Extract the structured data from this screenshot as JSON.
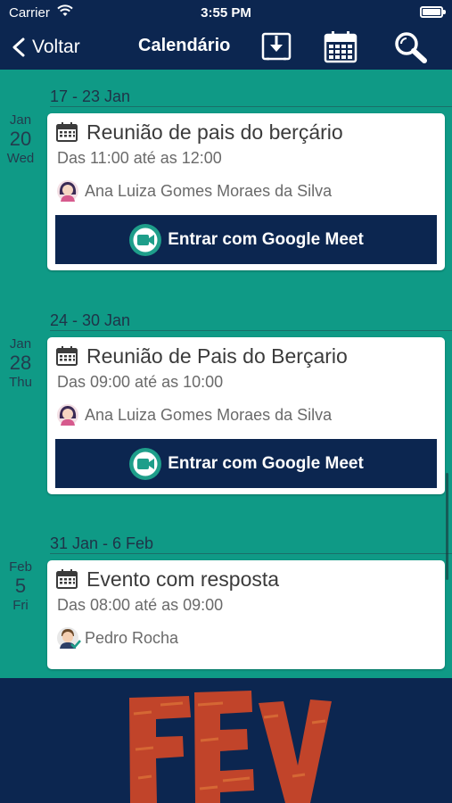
{
  "status_bar": {
    "carrier": "Carrier",
    "time": "3:55 PM"
  },
  "nav": {
    "back_label": "Voltar",
    "title": "Calendário",
    "icons": [
      "download-icon",
      "calendar-icon",
      "search-icon"
    ]
  },
  "weeks": [
    {
      "range": "17 - 23 Jan",
      "date": {
        "month": "Jan",
        "day": "20",
        "weekday": "Wed"
      },
      "event": {
        "title": "Reunião de pais do berçário",
        "time": "Das 11:00 até as 12:00",
        "organizer": "Ana Luiza Gomes Moraes da Silva",
        "button": "Entrar com Google Meet"
      }
    },
    {
      "range": "24 - 30 Jan",
      "date": {
        "month": "Jan",
        "day": "28",
        "weekday": "Thu"
      },
      "event": {
        "title": "Reunião de Pais do Berçario",
        "time": "Das 09:00 até as 10:00",
        "organizer": "Ana Luiza Gomes Moraes da Silva",
        "button": "Entrar com Google Meet"
      }
    },
    {
      "range": "31 Jan - 6 Feb",
      "date": {
        "month": "Feb",
        "day": "5",
        "weekday": "Fri"
      },
      "event": {
        "title": "Evento com resposta",
        "time": "Das 08:00 até as 09:00",
        "organizer": "Pedro Rocha"
      }
    }
  ],
  "banner": {
    "logo_text": "FEV"
  },
  "colors": {
    "navy": "#0c2650",
    "teal": "#0f9a86",
    "meet_green": "#1e9e8a",
    "logo_red": "#c1442a"
  }
}
